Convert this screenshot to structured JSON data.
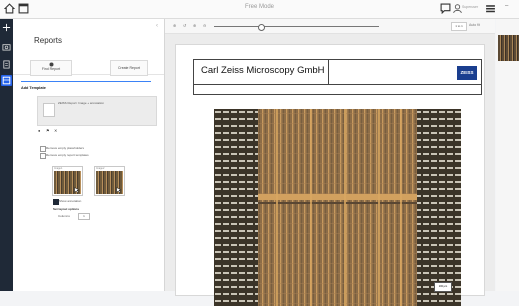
{
  "window": {
    "title": "Free Mode",
    "user": "Superuser",
    "home_icon": "home-icon",
    "app_icon": "window-icon"
  },
  "rail": {
    "icons": [
      "plus-icon",
      "camera-icon",
      "document-icon",
      "report-icon"
    ],
    "active_index": 3
  },
  "panel": {
    "title": "Reports",
    "close_label": "‹",
    "buttons": {
      "find_report": "Find Report",
      "create_report": "Create Report"
    },
    "section_title": "Add Template",
    "template_name": "ZEISS Report: Image + annotation",
    "checkboxes": [
      {
        "label": "Remove empty placeholders",
        "checked": false
      },
      {
        "label": "Remove empty report templates",
        "checked": false
      },
      {
        "label": "Show annotation",
        "checked": true
      }
    ],
    "thumbnails": [
      {
        "label": "Image1"
      },
      {
        "label": "Image2"
      }
    ],
    "layout_options_label": "Set layout options",
    "columns_label": "Columns",
    "columns_value": "1"
  },
  "toolbar": {
    "zoom_value": "1 to 1",
    "fit_label": "Auto fit"
  },
  "report": {
    "company": "Carl Zeiss Microscopy GmbH",
    "logo": "ZEISS",
    "scale_label": "100 µm"
  },
  "colors": {
    "accent": "#3b82f6",
    "rail_bg": "#1f2937",
    "logo_blue": "#1a3e8f"
  }
}
